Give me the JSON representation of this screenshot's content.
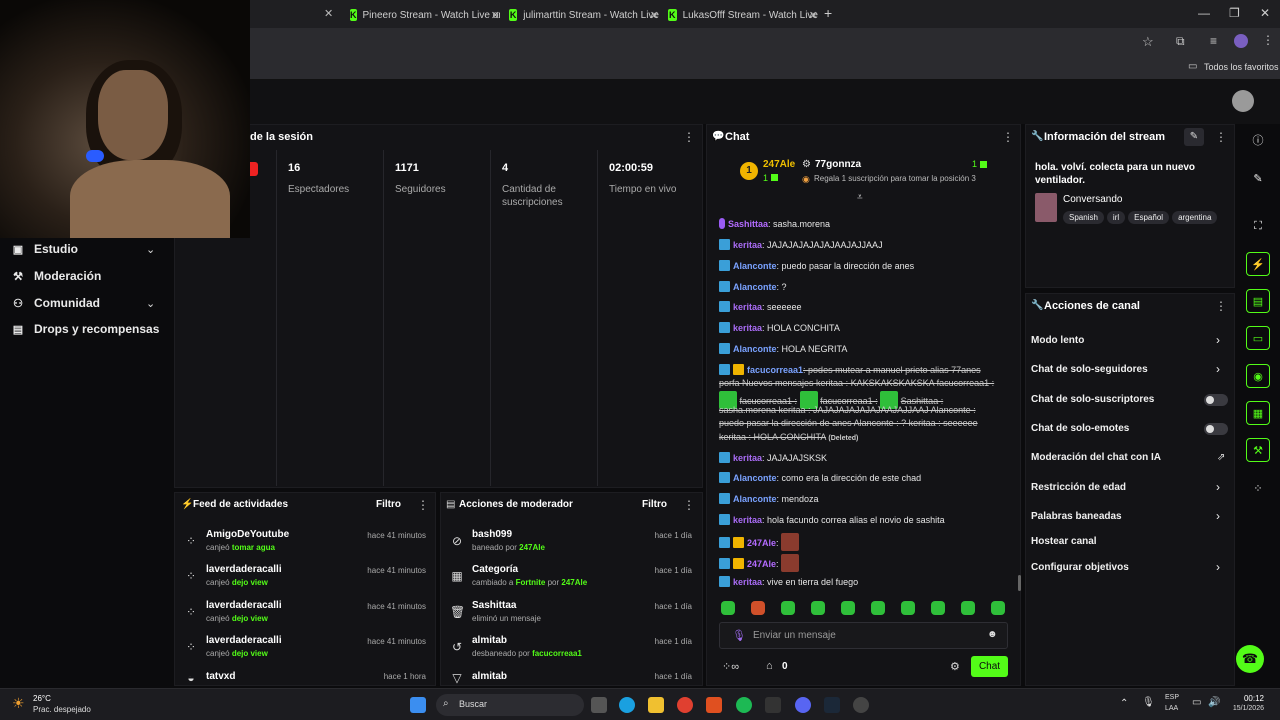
{
  "browser": {
    "tabs": [
      {
        "label": "Pineero Stream - Watch Live on"
      },
      {
        "label": "julimarttin Stream - Watch Live"
      },
      {
        "label": "LukasOfff Stream - Watch Live"
      }
    ],
    "bookmarks_label": "Todos los favoritos"
  },
  "nav": {
    "items": [
      {
        "label": "Estudio"
      },
      {
        "label": "Moderación"
      },
      {
        "label": "Comunidad"
      },
      {
        "label": "Drops y recompensas"
      }
    ]
  },
  "session": {
    "title": "de la sesión",
    "stats": [
      {
        "value": "16",
        "label": "Espectadores"
      },
      {
        "value": "1171",
        "label": "Seguidores"
      },
      {
        "value": "4",
        "label": "Cantidad de suscripciones"
      },
      {
        "value": "02:00:59",
        "label": "Tiempo en vivo"
      }
    ]
  },
  "feed": {
    "title": "Feed de actividades",
    "filter": "Filtro",
    "items": [
      {
        "name": "AmigoDeYoutube",
        "action": "canjeó",
        "reward": "tomar agua",
        "time": "hace 41 minutos"
      },
      {
        "name": "laverdaderacalli",
        "action": "canjeó",
        "reward": "dejo view",
        "time": "hace 41 minutos"
      },
      {
        "name": "laverdaderacalli",
        "action": "canjeó",
        "reward": "dejo view",
        "time": "hace 41 minutos"
      },
      {
        "name": "laverdaderacalli",
        "action": "canjeó",
        "reward": "dejo view",
        "time": "hace 41 minutos"
      },
      {
        "name": "tatvxd",
        "action": "",
        "reward": "",
        "time": "hace 1 hora"
      }
    ]
  },
  "modactions": {
    "title": "Acciones de moderador",
    "filter": "Filtro",
    "items": [
      {
        "name": "bash099",
        "sub1": "baneado por ",
        "by": "247Ale",
        "sub2": "",
        "time": "hace 1 día"
      },
      {
        "name": "Categoría",
        "sub1": "cambiado a ",
        "by": "Fortnite",
        "sub2": " por ",
        "by2": "247Ale",
        "time": "hace 1 día"
      },
      {
        "name": "Sashittaa",
        "sub1": "eliminó un mensaje",
        "by": "",
        "sub2": "",
        "time": "hace 1 día"
      },
      {
        "name": "almitab",
        "sub1": "desbaneado por ",
        "by": "facucorreaa1",
        "sub2": "",
        "time": "hace 1 día"
      },
      {
        "name": "almitab",
        "sub1": "",
        "by": "",
        "sub2": "",
        "time": "hace 1 día"
      }
    ]
  },
  "chat": {
    "title": "Chat",
    "pinned": {
      "rank": "1",
      "user1": "247Ale",
      "count1": "1",
      "user2": "77gonnza",
      "count2": "1",
      "gift_text": "Regala 1 suscripción para tomar la posición 3"
    },
    "messages": [
      {
        "user": "Sashittaa",
        "text": ": sasha.morena",
        "style": "purple"
      },
      {
        "user": "keritaa",
        "text": ": JAJAJAJAJAJAJAAJAJJAAJ",
        "style": "purple2"
      },
      {
        "user": "Alanconte",
        "text": ": puedo pasar la dirección de anes",
        "style": "blue"
      },
      {
        "user": "Alanconte",
        "text": ": ?",
        "style": "blue"
      },
      {
        "user": "keritaa",
        "text": ": seeeeee",
        "style": "purple2"
      },
      {
        "user": "keritaa",
        "text": ": HOLA CONCHITA",
        "style": "purple2"
      },
      {
        "user": "Alanconte",
        "text": ": HOLA NEGRITA",
        "style": "blue"
      }
    ],
    "deleted": {
      "user": "facucorreaa1",
      "line1": ": podes mutear a manuel prieto alias 77anes",
      "line2": "porfa Nuevos mensajes keritaa : KAKSKAKSKAKSKA facucorreaa1 :",
      "line3a": "facucorreaa1 :",
      "line3b": "facucorreaa1 :",
      "line3c": "Sashittaa :",
      "line4": "sasha.morena keritaa : JAJAJAJAJAJAJAAJAJJAAJ Alanconte :",
      "line5": "puedo pasar la dirección de anes Alanconte : ? keritaa : seeeeee",
      "line6": "keritaa : HOLA CONCHITA",
      "deleted_tag": "(Deleted)"
    },
    "messages2": [
      {
        "user": "keritaa",
        "text": ": JAJAJAJSKSK",
        "style": "purple2"
      },
      {
        "user": "Alanconte",
        "text": ": como era la dirección de este chad",
        "style": "blue"
      },
      {
        "user": "Alanconte",
        "text": ": mendoza",
        "style": "blue"
      },
      {
        "user": "keritaa",
        "text": ": hola facundo correa alias el novio de sashita",
        "style": "purple2"
      },
      {
        "user": "247Ale",
        "text": ":",
        "style": "purple"
      },
      {
        "user": "247Ale",
        "text": ":",
        "style": "purple"
      },
      {
        "user": "keritaa",
        "text": ": vive en tierra del fuego",
        "style": "purple2"
      }
    ],
    "input_placeholder": "Enviar un mensaje",
    "viewer_count": "0",
    "send_label": "Chat"
  },
  "streaminfo": {
    "title": "Información del stream",
    "description": "hola. volví. colecta para un nuevo ventilador.",
    "category": "Conversando",
    "tags": [
      "Spanish",
      "irl",
      "Español",
      "argentina"
    ]
  },
  "channel_actions": {
    "title": "Acciones de canal",
    "items": [
      {
        "label": "Modo lento"
      },
      {
        "label": "Chat de solo-seguidores"
      },
      {
        "label": "Chat de solo-suscriptores"
      },
      {
        "label": "Chat de solo-emotes"
      },
      {
        "label": "Moderación del chat con IA"
      },
      {
        "label": "Restricción de edad"
      },
      {
        "label": "Palabras baneadas"
      },
      {
        "label": "Hostear canal"
      },
      {
        "label": "Configurar objetivos"
      }
    ]
  },
  "taskbar": {
    "temp": "26°C",
    "weather": "Prac. despejado",
    "search": "Buscar",
    "lang1": "ESP",
    "lang2": "LAA",
    "time": "00:12",
    "date": "15/1/2026"
  },
  "colors": {
    "accent": "#53fc18",
    "bg": "#0b0b0d",
    "panel": "#131316"
  }
}
